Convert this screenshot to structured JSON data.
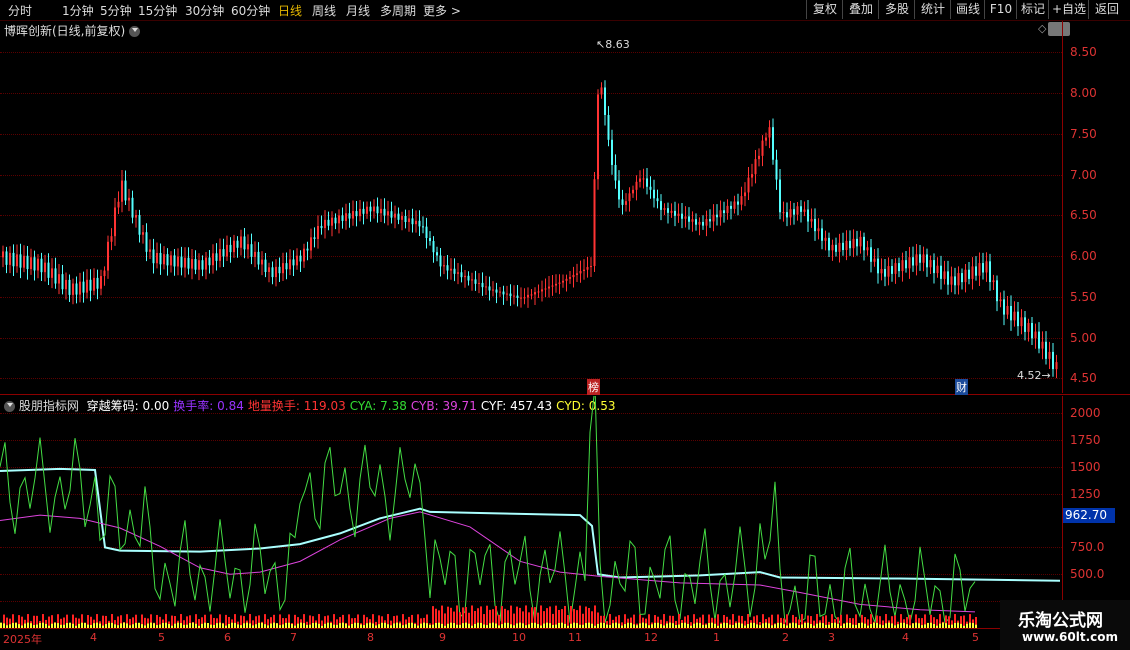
{
  "toolbar": {
    "periods": [
      "分时",
      "1分钟",
      "5分钟",
      "15分钟",
      "30分钟",
      "60分钟",
      "日线",
      "周线",
      "月线",
      "多周期",
      "更多 >"
    ],
    "active_period": "日线",
    "buttons": [
      "复权",
      "叠加",
      "多股",
      "统计",
      "画线",
      "F10",
      "标记",
      "+自选",
      "返回"
    ]
  },
  "main_panel": {
    "title": "博晖创新(日线,前复权)",
    "high_label": "8.63",
    "low_label": "4.52",
    "event_marks": [
      "榜",
      "财"
    ],
    "price_ticks": [
      "8.50",
      "8.00",
      "7.50",
      "7.00",
      "6.50",
      "6.00",
      "5.50",
      "5.00",
      "4.50"
    ]
  },
  "indicator_panel": {
    "name": "股朋指标网",
    "items": [
      {
        "label": "穿越筹码:",
        "value": "0.00",
        "color": "#ffffff"
      },
      {
        "label": "换手率:",
        "value": "0.84",
        "color": "#9933ff"
      },
      {
        "label": "地量换手:",
        "value": "119.03",
        "color": "#ff3333"
      },
      {
        "label": "CYA:",
        "value": "7.38",
        "color": "#33dd33"
      },
      {
        "label": "CYB:",
        "value": "39.71",
        "color": "#dd44dd"
      },
      {
        "label": "CYF:",
        "value": "457.43",
        "color": "#ffffff"
      },
      {
        "label": "CYD:",
        "value": "0.53",
        "color": "#ffff33"
      }
    ],
    "ticks": [
      "2000",
      "1750",
      "1500",
      "1250",
      "750.0",
      "500.0"
    ],
    "current_value": "962.70"
  },
  "date_axis": [
    "2025年",
    "4",
    "5",
    "6",
    "7",
    "8",
    "9",
    "10",
    "11",
    "12",
    "1",
    "2",
    "3",
    "4",
    "5"
  ],
  "watermark": {
    "title": "乐淘公式网",
    "url": "www.60lt.com"
  }
}
